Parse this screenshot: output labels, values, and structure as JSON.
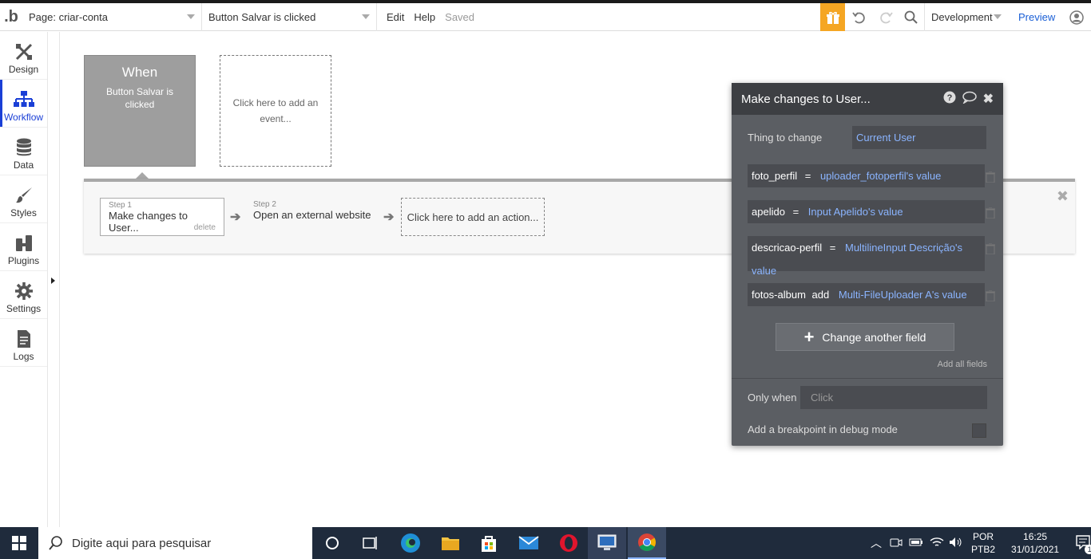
{
  "topbar": {
    "page_label": "Page: criar-conta",
    "event_selector": "Button Salvar is clicked",
    "edit": "Edit",
    "help": "Help",
    "saved": "Saved",
    "environment": "Development",
    "preview": "Preview"
  },
  "sidebar": {
    "items": [
      {
        "label": "Design",
        "icon": "design-icon"
      },
      {
        "label": "Workflow",
        "icon": "workflow-icon"
      },
      {
        "label": "Data",
        "icon": "database-icon"
      },
      {
        "label": "Styles",
        "icon": "brush-icon"
      },
      {
        "label": "Plugins",
        "icon": "plugin-icon"
      },
      {
        "label": "Settings",
        "icon": "gear-icon"
      },
      {
        "label": "Logs",
        "icon": "document-icon"
      }
    ]
  },
  "workflow": {
    "event": {
      "when": "When",
      "name": "Button Salvar is clicked"
    },
    "add_event": "Click here to add an event...",
    "steps": [
      {
        "num": "Step 1",
        "label": "Make changes to User...",
        "delete": "delete"
      },
      {
        "num": "Step 2",
        "label": "Open an external website"
      }
    ],
    "add_action": "Click here to add an action..."
  },
  "panel": {
    "title": "Make changes to User...",
    "thing_label": "Thing to change",
    "thing_value": "Current User",
    "fields": [
      {
        "name": "foto_perfil",
        "op": "=",
        "value": "uploader_fotoperfil's value"
      },
      {
        "name": "apelido",
        "op": "=",
        "value": "Input Apelido's value"
      },
      {
        "name": "descricao-perfil",
        "op": "=",
        "value": "MultilineInput Descrição's value"
      },
      {
        "name": "fotos-album",
        "op": "add",
        "value": "Multi-FileUploader A's value"
      }
    ],
    "change_another": "Change another field",
    "add_all": "Add all fields",
    "only_when": "Only when",
    "only_when_placeholder": "Click",
    "breakpoint": "Add a breakpoint in debug mode"
  },
  "taskbar": {
    "search_placeholder": "Digite aqui para pesquisar",
    "lang_top": "POR",
    "lang_bottom": "PTB2",
    "time": "16:25",
    "date": "31/01/2021",
    "notification_count": "1"
  }
}
